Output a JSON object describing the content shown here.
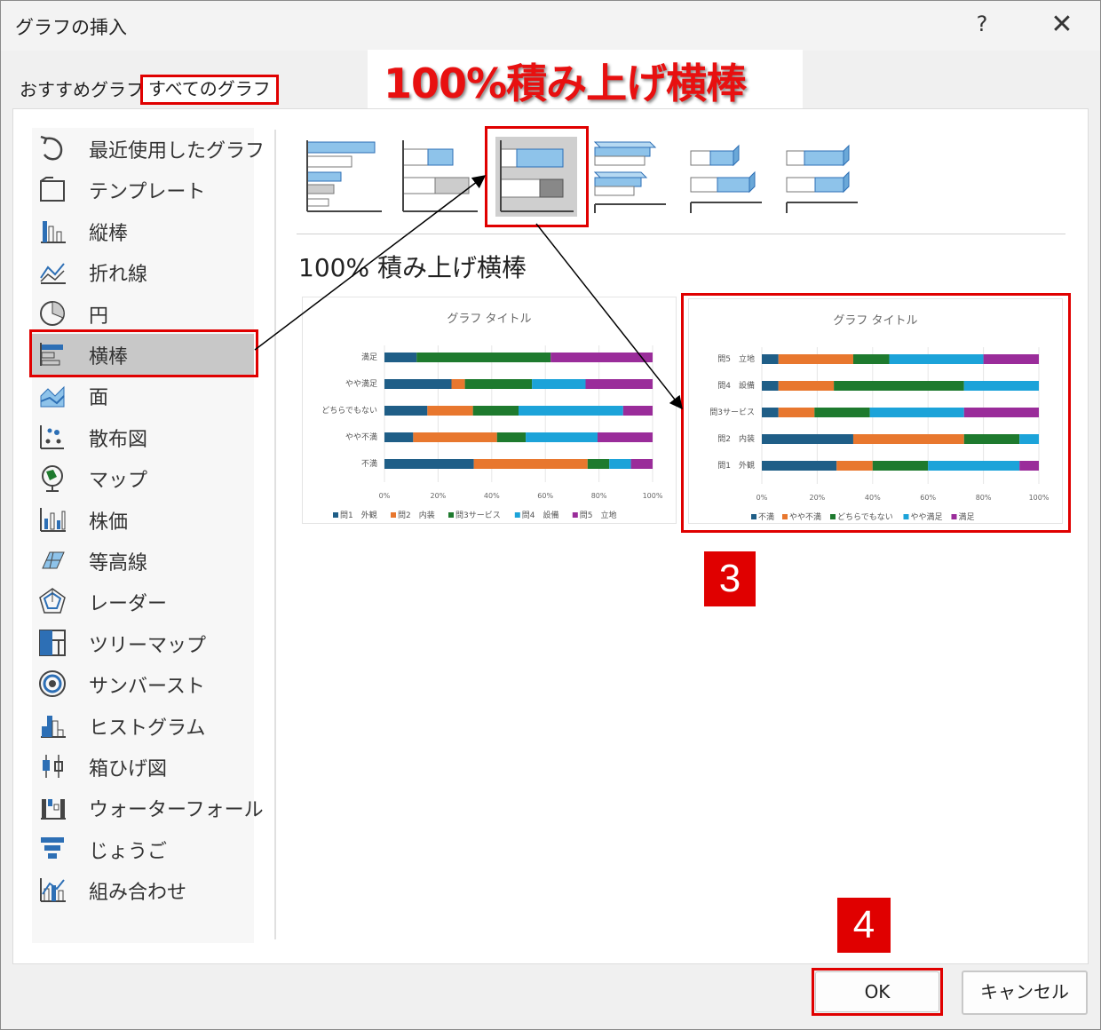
{
  "window": {
    "title": "グラフの挿入",
    "help": "?",
    "close": "✕"
  },
  "tabs": [
    {
      "label": "おすすめグラフ",
      "selected": false
    },
    {
      "label": "すべてのグラフ",
      "selected": true
    }
  ],
  "annotation_title": "100%積み上げ横棒",
  "sidebar": {
    "items": [
      {
        "label": "最近使用したグラフ",
        "icon": "recent-icon"
      },
      {
        "label": "テンプレート",
        "icon": "template-icon"
      },
      {
        "label": "縦棒",
        "icon": "column-chart-icon"
      },
      {
        "label": "折れ線",
        "icon": "line-chart-icon"
      },
      {
        "label": "円",
        "icon": "pie-chart-icon"
      },
      {
        "label": "横棒",
        "icon": "bar-chart-icon",
        "selected": true
      },
      {
        "label": "面",
        "icon": "area-chart-icon"
      },
      {
        "label": "散布図",
        "icon": "scatter-chart-icon"
      },
      {
        "label": "マップ",
        "icon": "map-chart-icon"
      },
      {
        "label": "株価",
        "icon": "stock-chart-icon"
      },
      {
        "label": "等高線",
        "icon": "surface-chart-icon"
      },
      {
        "label": "レーダー",
        "icon": "radar-chart-icon"
      },
      {
        "label": "ツリーマップ",
        "icon": "treemap-chart-icon"
      },
      {
        "label": "サンバースト",
        "icon": "sunburst-chart-icon"
      },
      {
        "label": "ヒストグラム",
        "icon": "histogram-chart-icon"
      },
      {
        "label": "箱ひげ図",
        "icon": "boxwhisker-chart-icon"
      },
      {
        "label": "ウォーターフォール",
        "icon": "waterfall-chart-icon"
      },
      {
        "label": "じょうご",
        "icon": "funnel-chart-icon"
      },
      {
        "label": "組み合わせ",
        "icon": "combo-chart-icon"
      }
    ]
  },
  "subtype_title": "100% 積み上げ横棒",
  "badges": {
    "step3": "3",
    "step4": "4"
  },
  "buttons": {
    "ok": "OK",
    "cancel": "キャンセル"
  },
  "colors": {
    "accent_red": "#e00000",
    "s1": "#1f5e87",
    "s2": "#e8772e",
    "s3": "#1e7a2e",
    "s4": "#1ca3d9",
    "s5": "#9a2c9a"
  },
  "chart_data": [
    {
      "type": "bar",
      "stacked": "100%",
      "title": "グラフ タイトル",
      "categories": [
        "不満",
        "やや不満",
        "どちらでもない",
        "やや満足",
        "満足"
      ],
      "series": [
        {
          "name": "問1　外観",
          "values": [
            33,
            12,
            16,
            25,
            12
          ]
        },
        {
          "name": "問2　内装",
          "values": [
            42,
            35,
            17,
            5,
            0
          ]
        },
        {
          "name": "問3サービス",
          "values": [
            8,
            12,
            17,
            25,
            50
          ]
        },
        {
          "name": "問4　設備",
          "values": [
            8,
            30,
            39,
            20,
            0
          ]
        },
        {
          "name": "問5　立地",
          "values": [
            8,
            23,
            11,
            25,
            38
          ]
        }
      ],
      "xticks": [
        "0%",
        "20%",
        "40%",
        "60%",
        "80%",
        "100%"
      ],
      "legend": "bottom"
    },
    {
      "type": "bar",
      "stacked": "100%",
      "title": "グラフ タイトル",
      "categories": [
        "問1　外観",
        "問2　内装",
        "問3サービス",
        "問4　設備",
        "問5　立地"
      ],
      "series": [
        {
          "name": "不満",
          "values": [
            27,
            33,
            6,
            6,
            6
          ]
        },
        {
          "name": "やや不満",
          "values": [
            13,
            40,
            13,
            20,
            27
          ]
        },
        {
          "name": "どちらでもない",
          "values": [
            20,
            20,
            20,
            47,
            13
          ]
        },
        {
          "name": "やや満足",
          "values": [
            33,
            7,
            34,
            27,
            34
          ]
        },
        {
          "name": "満足",
          "values": [
            7,
            0,
            27,
            0,
            20
          ]
        }
      ],
      "xticks": [
        "0%",
        "20%",
        "40%",
        "60%",
        "80%",
        "100%"
      ],
      "legend": "bottom"
    }
  ]
}
